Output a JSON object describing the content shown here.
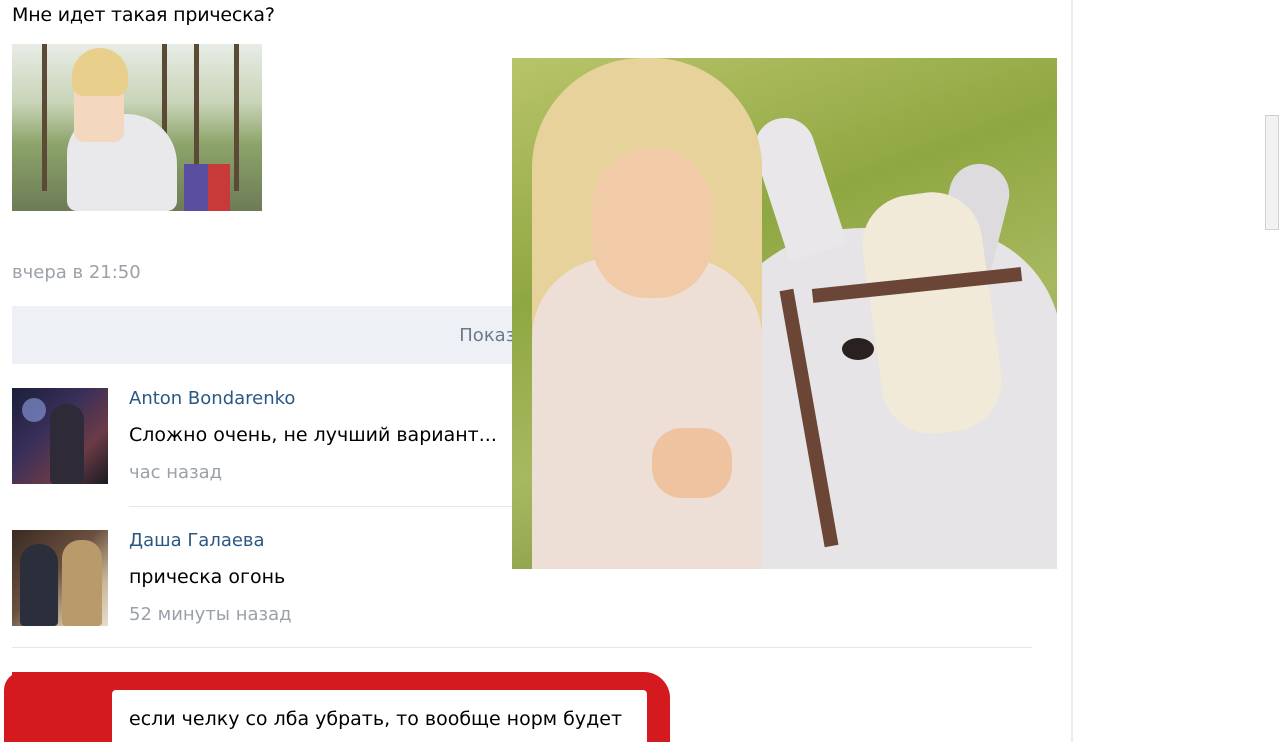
{
  "post": {
    "text": "Мне идет такая прическа?",
    "time": "вчера в 21:50"
  },
  "show_all_label": "Показать все",
  "comments": [
    {
      "author": "Anton Bondarenko",
      "text": "Сложно очень, не лучший вариант...",
      "time": "час назад"
    },
    {
      "author": "Даша Галаева",
      "text": "прическа огонь",
      "time": "52 минуты назад"
    },
    {
      "author": "",
      "text": "если челку со лба убрать, то вообще норм будет",
      "time": ""
    }
  ],
  "colors": {
    "author_link": "#2a5885",
    "muted_text": "#9aa1a8",
    "show_all_bg": "#edf0f4",
    "redaction": "#d4191f"
  }
}
